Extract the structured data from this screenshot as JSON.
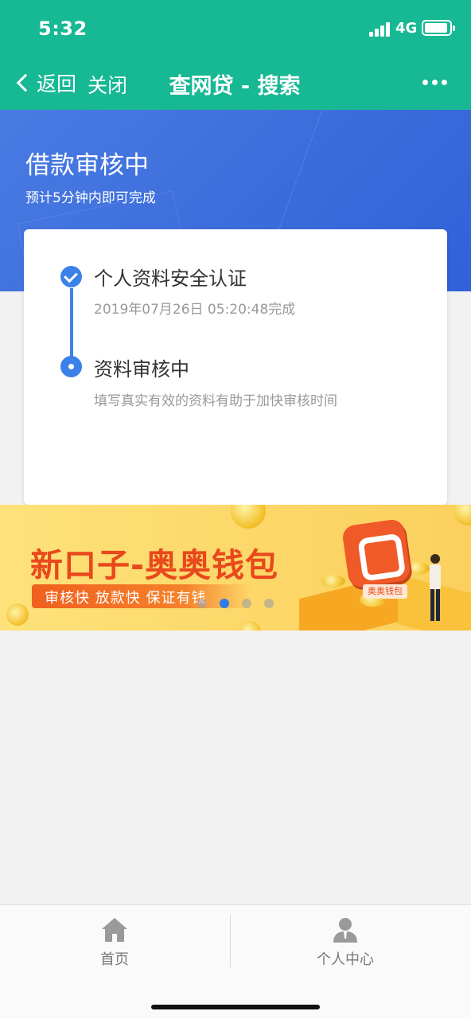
{
  "status_bar": {
    "time": "5:32",
    "network": "4G"
  },
  "nav": {
    "back_label": "返回",
    "close_label": "关闭",
    "title": "查网贷 - 搜索"
  },
  "header": {
    "title": "借款审核中",
    "subtitle": "预计5分钟内即可完成"
  },
  "steps": [
    {
      "title": "个人资料安全认证",
      "detail": "2019年07月26日 05:20:48完成",
      "state": "done"
    },
    {
      "title": "资料审核中",
      "detail": "填写真实有效的资料有助于加快审核时间",
      "state": "current"
    }
  ],
  "banner": {
    "title": "新口子-奥奥钱包",
    "tagline": "审核快  放款快  保证有钱",
    "app_label": "奥奥钱包",
    "pager": {
      "count": 4,
      "active_index": 1
    }
  },
  "tabbar": {
    "items": [
      {
        "label": "首页",
        "icon": "home-icon"
      },
      {
        "label": "个人中心",
        "icon": "user-icon"
      }
    ]
  },
  "colors": {
    "nav_green": "#17b894",
    "accent_blue": "#3b82e8",
    "banner_red": "#e9481c"
  }
}
